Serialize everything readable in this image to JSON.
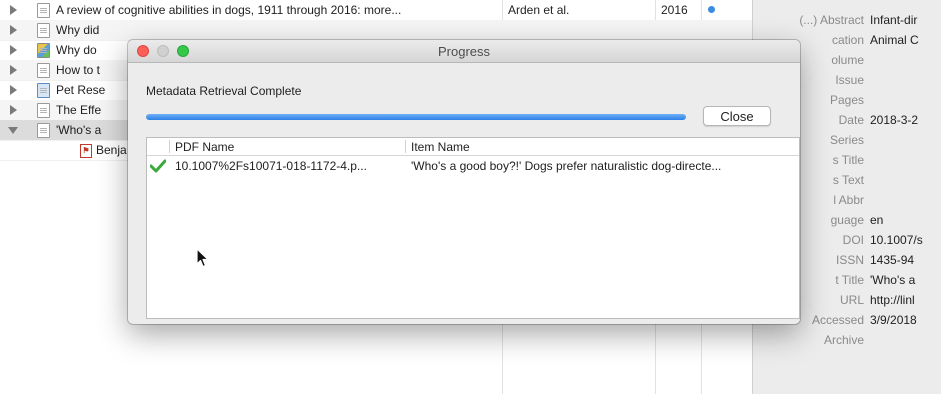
{
  "library": {
    "rows": [
      {
        "icon": "document-icon",
        "expanded": false,
        "title": "A review of cognitive abilities in dogs, 1911 through 2016: more...",
        "creator": "Arden et al.",
        "year": "2016",
        "has_attachment_dot": true
      },
      {
        "icon": "document-icon",
        "expanded": false,
        "title": "Why did",
        "creator": "",
        "year": "",
        "has_attachment_dot": false
      },
      {
        "icon": "image-document-icon",
        "expanded": false,
        "title": "Why do",
        "creator": "",
        "year": "",
        "has_attachment_dot": false
      },
      {
        "icon": "document-icon",
        "expanded": false,
        "title": "How to t",
        "creator": "",
        "year": "",
        "has_attachment_dot": false
      },
      {
        "icon": "web-page-icon",
        "expanded": false,
        "title": "Pet Rese",
        "creator": "",
        "year": "",
        "has_attachment_dot": false
      },
      {
        "icon": "document-icon",
        "expanded": false,
        "title": "The Effe",
        "creator": "",
        "year": "",
        "has_attachment_dot": false
      },
      {
        "icon": "document-icon",
        "expanded": true,
        "title": "'Who's a",
        "creator": "",
        "year": "",
        "has_attachment_dot": false,
        "selected": true
      }
    ],
    "child_row": {
      "icon": "pdf-icon",
      "title": "Benja"
    }
  },
  "info_pane": {
    "fields": [
      {
        "label": "(...) Abstract",
        "value": "Infant-dir"
      },
      {
        "label": "cation",
        "value": "Animal C"
      },
      {
        "label": "olume",
        "value": ""
      },
      {
        "label": "Issue",
        "value": ""
      },
      {
        "label": "Pages",
        "value": ""
      },
      {
        "label": "Date",
        "value": "2018-3-2"
      },
      {
        "label": "Series",
        "value": ""
      },
      {
        "label": "s Title",
        "value": ""
      },
      {
        "label": "s Text",
        "value": ""
      },
      {
        "label": "l Abbr",
        "value": ""
      },
      {
        "label": "guage",
        "value": "en"
      },
      {
        "label": "DOI",
        "value": "10.1007/s"
      },
      {
        "label": "ISSN",
        "value": "1435-94"
      },
      {
        "label": "t Title",
        "value": "'Who's a"
      },
      {
        "label": "URL",
        "value": "http://linl"
      },
      {
        "label": "Accessed",
        "value": "3/9/2018"
      },
      {
        "label": "Archive",
        "value": ""
      }
    ]
  },
  "dialog": {
    "title": "Progress",
    "status": "Metadata Retrieval Complete",
    "progress": 1.0,
    "close_label": "Close",
    "columns": [
      "PDF Name",
      "Item Name"
    ],
    "rows": [
      {
        "status_icon": "checkmark-icon",
        "pdf_name": "10.1007%2Fs10071-018-1172-4.p...",
        "item_name": "'Who's a good boy?!' Dogs prefer naturalistic dog-directe..."
      }
    ]
  },
  "colors": {
    "accent": "#2e7fe6",
    "success": "#3aa83a",
    "attachment_dot": "#3b8be0"
  }
}
